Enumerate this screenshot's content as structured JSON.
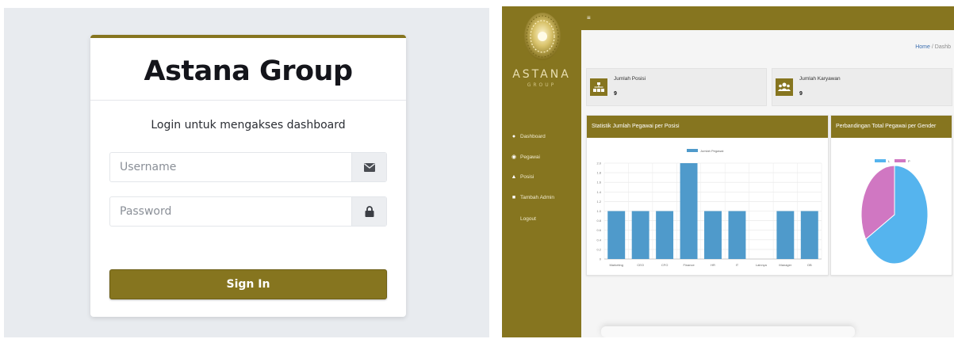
{
  "login": {
    "title": "Astana Group",
    "message": "Login untuk mengakses dashboard",
    "username_placeholder": "Username",
    "password_placeholder": "Password",
    "signin_label": "Sign In",
    "accent_color": "#86751f"
  },
  "dashboard": {
    "logo_text": "ASTANA",
    "logo_sub": "GROUP",
    "menu_icon": "hamburger-icon",
    "breadcrumb": {
      "home": "Home",
      "separator": "/",
      "current": "Dashb"
    },
    "nav": [
      {
        "label": "Dashboard",
        "icon": "dashboard-icon"
      },
      {
        "label": "Pegawai",
        "icon": "users-icon"
      },
      {
        "label": "Posisi",
        "icon": "sitemap-icon"
      },
      {
        "label": "Tambah Admin",
        "icon": "user-icon"
      },
      {
        "label": "Logout",
        "icon": ""
      }
    ],
    "cards": [
      {
        "label": "Jumlah Posisi",
        "value": "9",
        "icon": "sitemap-icon"
      },
      {
        "label": "Jumlah Karyawan",
        "value": "9",
        "icon": "users-icon"
      }
    ],
    "bar_panel_title": "Statistik Jumlah Pegawai per Posisi",
    "pie_panel_title": "Perbandingan Total Pegawai per Gender"
  },
  "chart_data": [
    {
      "type": "bar",
      "title": "",
      "legend": [
        "Jumlah Pegawai"
      ],
      "legend_position": "top",
      "categories": [
        "Marketing",
        "CEO",
        "CFO",
        "Finance",
        "HR",
        "IT",
        "Lainnya",
        "Manager",
        "OB"
      ],
      "series": [
        {
          "name": "Jumlah Pegawai",
          "values": [
            1,
            1,
            1,
            2,
            1,
            1,
            0,
            1,
            1
          ]
        }
      ],
      "ylim": [
        0,
        2
      ],
      "yticks": [
        "0",
        "0.2",
        "0.4",
        "0.6",
        "0.8",
        "1.0",
        "1.2",
        "1.4",
        "1.6",
        "1.8",
        "2.0"
      ],
      "grid": true,
      "color": "#4f9acb"
    },
    {
      "type": "pie",
      "title": "",
      "legend": [
        "L",
        "P"
      ],
      "legend_position": "top",
      "series": [
        {
          "values": [
            6,
            3
          ]
        }
      ],
      "colors": [
        "#55b4ee",
        "#d077c2"
      ]
    }
  ]
}
